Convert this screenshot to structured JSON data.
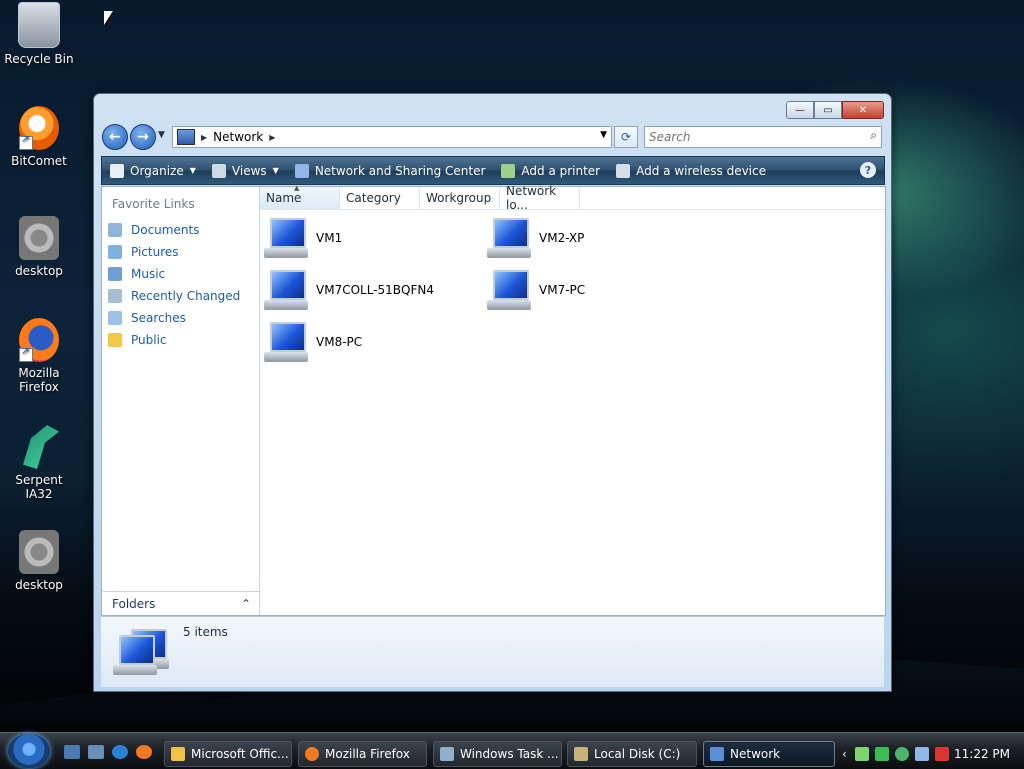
{
  "desktop": {
    "icons": [
      {
        "label": "Recycle Bin"
      },
      {
        "label": "BitComet"
      },
      {
        "label": "desktop"
      },
      {
        "label": "Mozilla Firefox"
      },
      {
        "label": "Serpent IA32"
      },
      {
        "label": "desktop"
      }
    ]
  },
  "window": {
    "breadcrumb": [
      "Network"
    ],
    "search_placeholder": "Search",
    "toolbar": {
      "organize": "Organize",
      "views": "Views",
      "network_sharing": "Network and Sharing Center",
      "add_printer": "Add a printer",
      "add_wireless": "Add a wireless device"
    },
    "nav": {
      "header": "Favorite Links",
      "links": [
        "Documents",
        "Pictures",
        "Music",
        "Recently Changed",
        "Searches",
        "Public"
      ],
      "folders_label": "Folders"
    },
    "columns": [
      "Name",
      "Category",
      "Workgroup",
      "Network lo..."
    ],
    "computers": [
      "VM1",
      "VM2-XP",
      "VM7COLL-51BQFN4",
      "VM7-PC",
      "VM8-PC"
    ],
    "details": {
      "count": "5 items"
    }
  },
  "taskbar": {
    "buttons": [
      "Microsoft Offic...",
      "Mozilla Firefox",
      "Windows Task ...",
      "Local Disk (C:)",
      "Network"
    ],
    "clock": "11:22 PM"
  },
  "colors": {
    "accent": "#2d4f6f",
    "link": "#1e5ca8"
  }
}
